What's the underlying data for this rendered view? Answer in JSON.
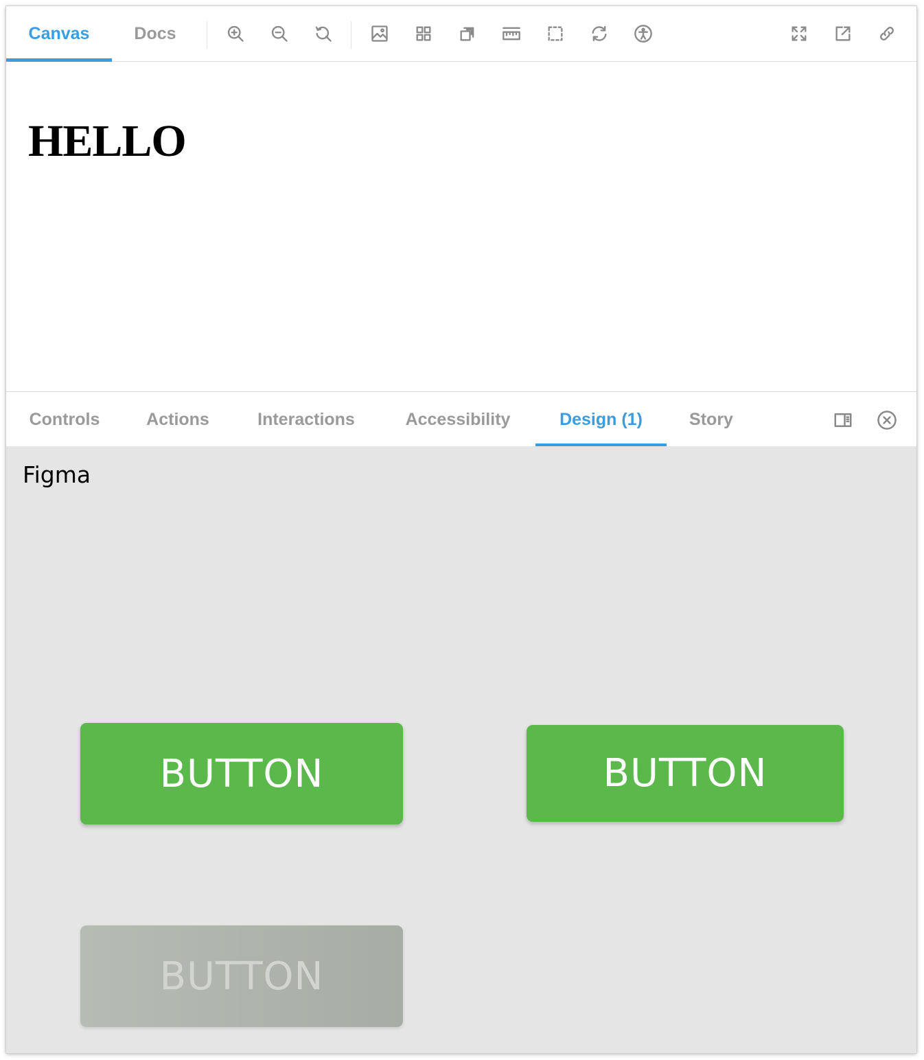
{
  "toolbar": {
    "tabs": [
      {
        "label": "Canvas",
        "active": true
      },
      {
        "label": "Docs",
        "active": false
      }
    ],
    "tools": [
      "zoom-in-icon",
      "zoom-out-icon",
      "zoom-reset-icon",
      "background-icon",
      "grid-icon",
      "viewport-icon",
      "measure-icon",
      "outline-icon",
      "remount-icon",
      "accessibility-icon"
    ],
    "right_tools": [
      "fullscreen-icon",
      "open-new-tab-icon",
      "copy-link-icon"
    ]
  },
  "preview": {
    "heading": "HELLO"
  },
  "addons": {
    "tabs": [
      {
        "label": "Controls",
        "active": false
      },
      {
        "label": "Actions",
        "active": false
      },
      {
        "label": "Interactions",
        "active": false
      },
      {
        "label": "Accessibility",
        "active": false
      },
      {
        "label": "Design (1)",
        "active": true
      },
      {
        "label": "Story",
        "active": false
      }
    ],
    "tools": [
      "panel-orientation-icon",
      "close-panel-icon"
    ]
  },
  "design": {
    "source_label": "Figma",
    "buttons": [
      {
        "label": "BUTTON",
        "state": "enabled"
      },
      {
        "label": "BUTTON",
        "state": "enabled"
      },
      {
        "label": "BUTTON",
        "state": "disabled"
      }
    ]
  },
  "colors": {
    "accent": "#3a9de0",
    "inactive_text": "#9a9a9a",
    "button_green": "#5bb94b",
    "button_disabled": "#aeb4ab",
    "panel_bg": "#e5e5e5"
  }
}
